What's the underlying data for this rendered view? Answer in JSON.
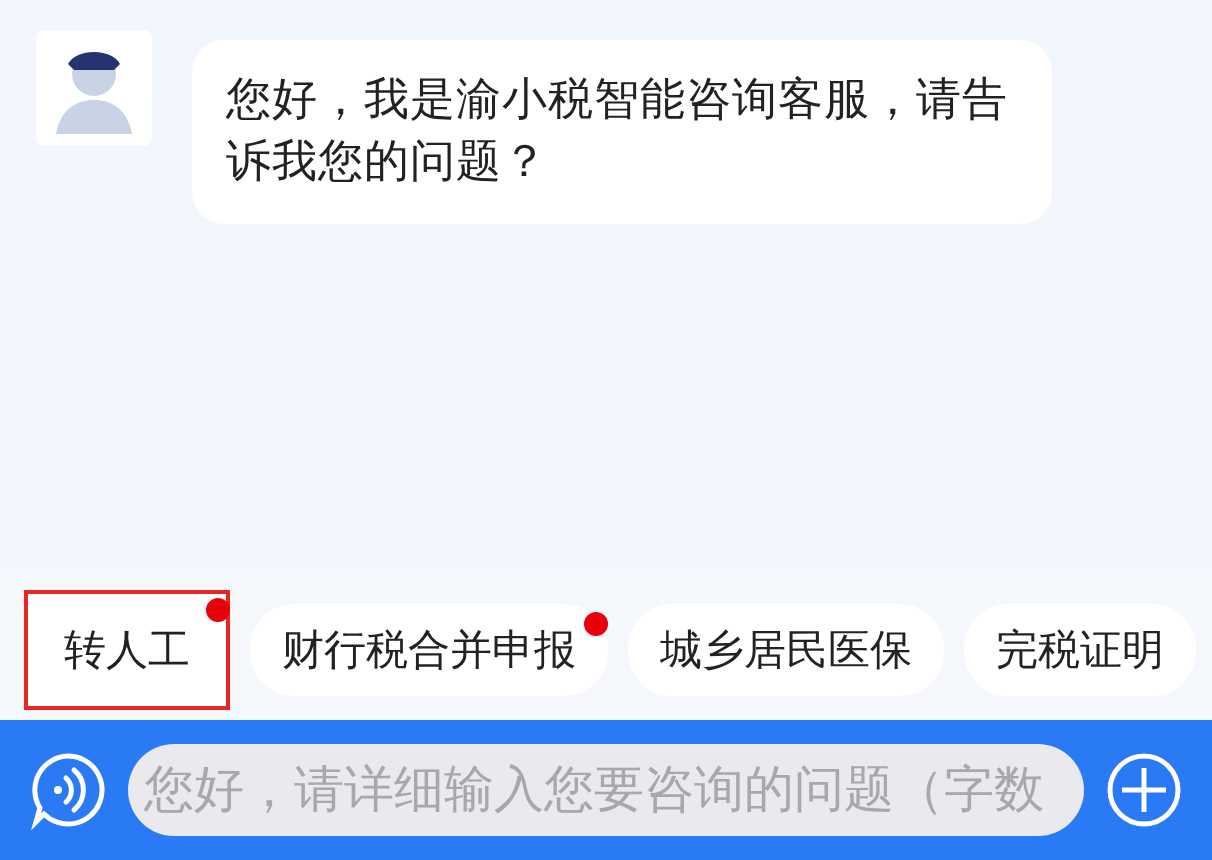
{
  "messages": [
    {
      "kind": "incoming",
      "text": "您好，我是渝小税智能咨询客服，请告诉我您的问题？"
    }
  ],
  "quick_replies": [
    {
      "label": "转人工",
      "badge": true,
      "highlighted": true
    },
    {
      "label": "财行税合并申报",
      "badge": true,
      "highlighted": false
    },
    {
      "label": "城乡居民医保",
      "badge": false,
      "highlighted": false
    },
    {
      "label": "完税证明",
      "badge": false,
      "highlighted": false
    }
  ],
  "input": {
    "placeholder": "您好，请详细输入您要咨询的问题（字数"
  }
}
